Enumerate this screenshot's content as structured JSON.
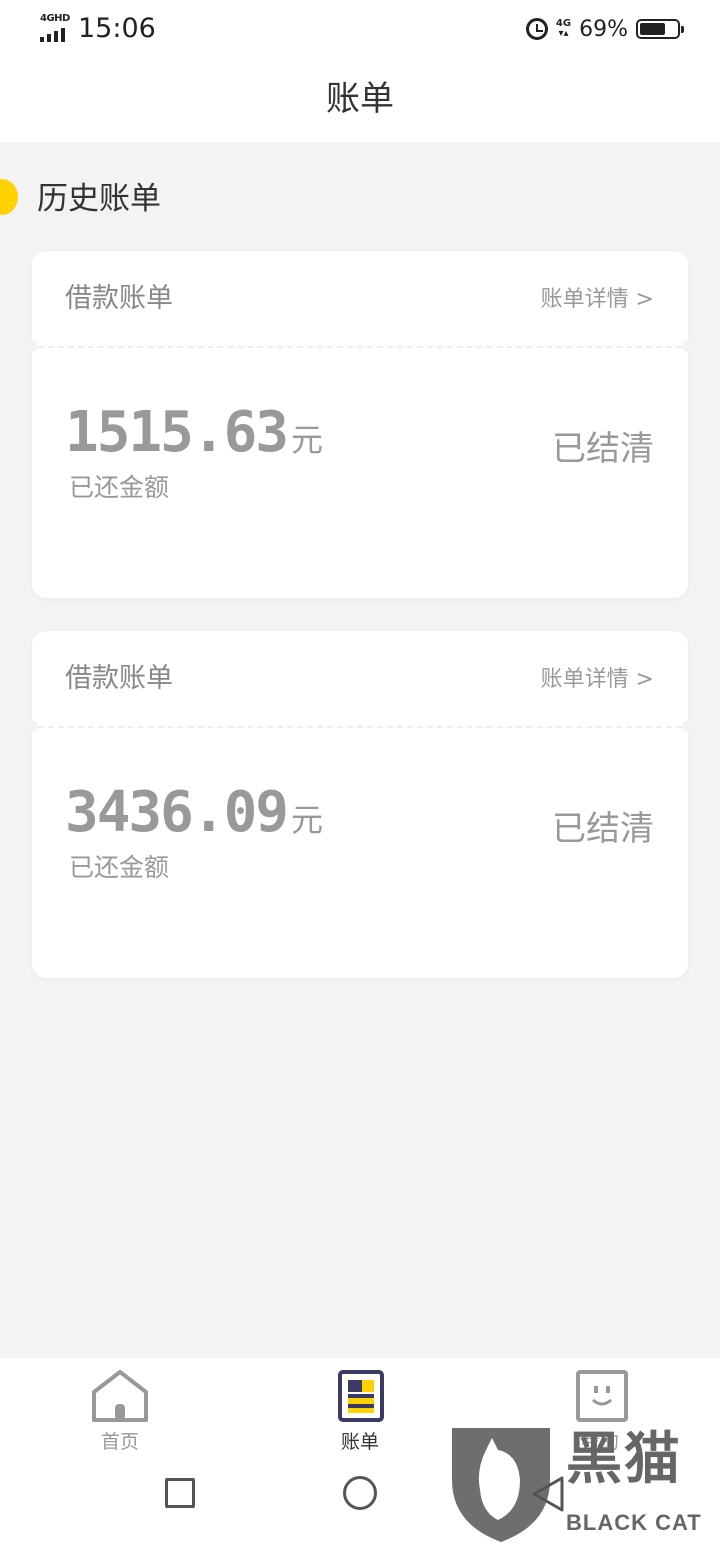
{
  "status_bar": {
    "network": "4GHD",
    "time": "15:06",
    "data_type": "4G",
    "battery_percent": "69%",
    "battery_level": 0.69
  },
  "header": {
    "title": "账单"
  },
  "section": {
    "title": "历史账单"
  },
  "bills": [
    {
      "type": "借款账单",
      "detail_link": "账单详情 >",
      "amount": "1515.63",
      "unit": "元",
      "amount_label": "已还金额",
      "status": "已结清"
    },
    {
      "type": "借款账单",
      "detail_link": "账单详情 >",
      "amount": "3436.09",
      "unit": "元",
      "amount_label": "已还金额",
      "status": "已结清"
    }
  ],
  "bottom_nav": {
    "items": [
      {
        "label": "首页",
        "icon": "home-icon",
        "active": false
      },
      {
        "label": "账单",
        "icon": "bill-icon",
        "active": true
      },
      {
        "label": "我的",
        "icon": "profile-icon",
        "active": false
      }
    ]
  },
  "watermark": {
    "text": "黑猫",
    "subtext": "BLACK CAT"
  },
  "colors": {
    "accent": "#ffd200",
    "nav_active": "#3b3a63",
    "background": "#f3f3f3"
  }
}
